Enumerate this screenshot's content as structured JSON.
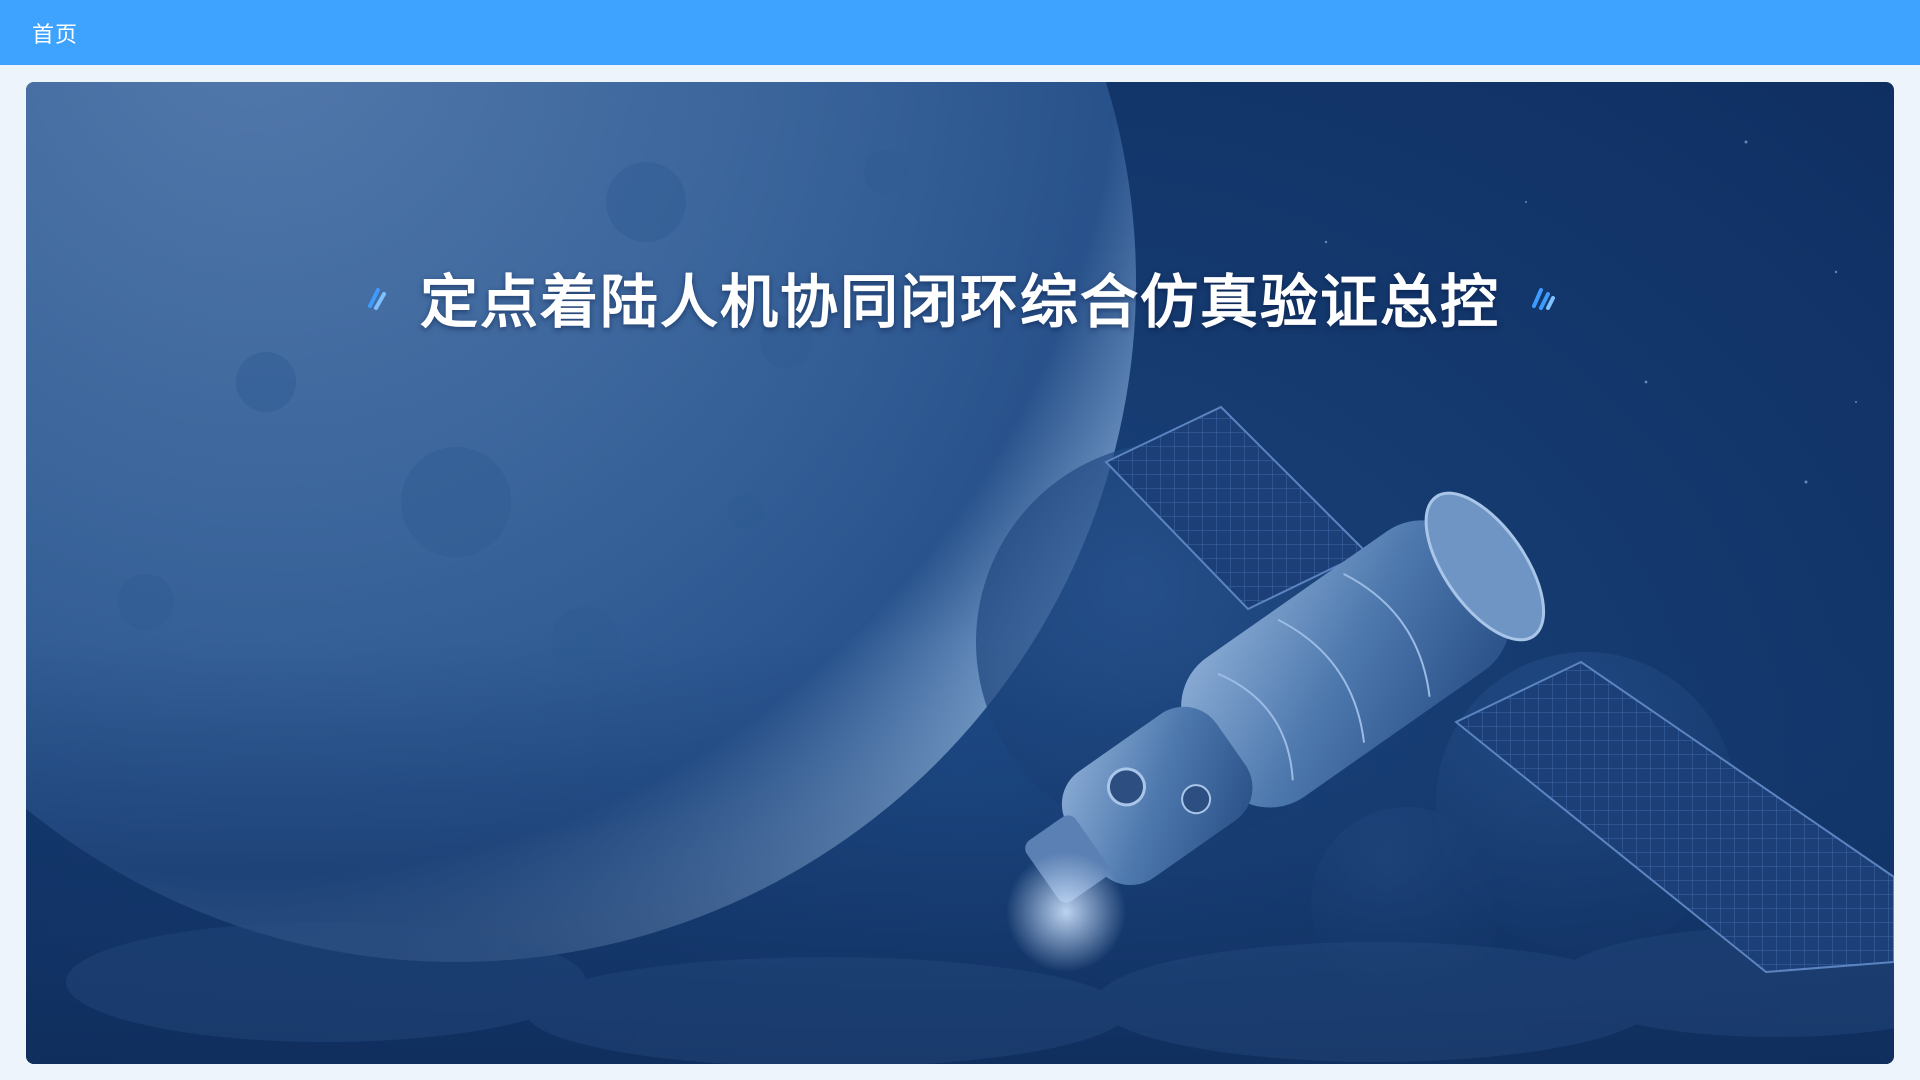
{
  "header": {
    "tab_home_label": "首页",
    "background_color": "#3ea2ff"
  },
  "main": {
    "title": "定点着陆人机协同闭环综合仿真验证总控",
    "background_illustration": "moon-and-spacecraft",
    "decorations": {
      "left": "slash-marks-icon",
      "right": "slash-marks-icon"
    },
    "accent_color": "#3e9bff",
    "background_color": "#163c72"
  }
}
